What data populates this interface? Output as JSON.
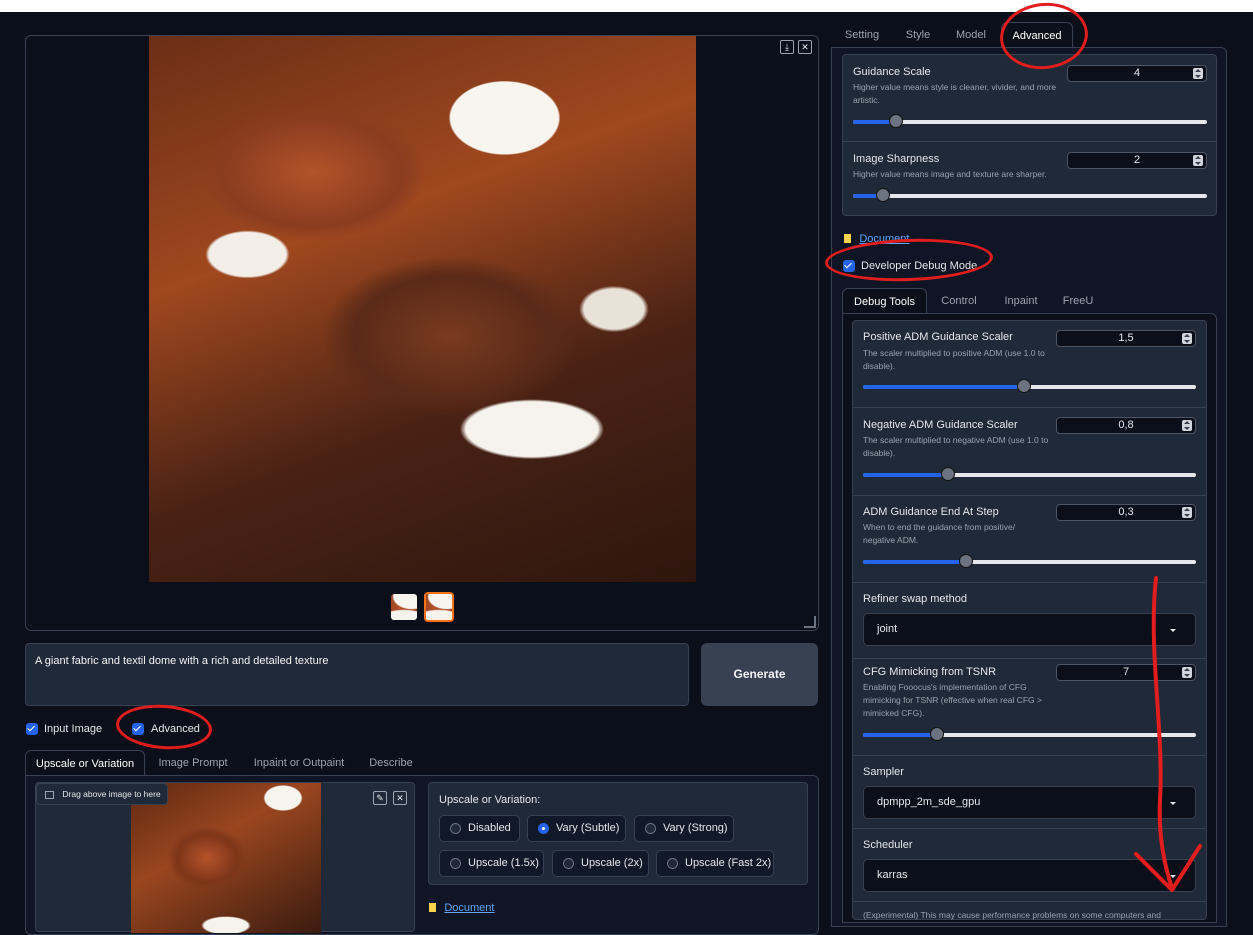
{
  "gallery": {
    "download_icon": "download-icon",
    "close_icon": "close-icon"
  },
  "prompt": {
    "text": "A giant fabric and textil dome with a rich and detailed texture"
  },
  "generate_label": "Generate",
  "options": {
    "input_image_label": "Input Image",
    "advanced_label": "Advanced"
  },
  "input_tabs": [
    "Upscale or Variation",
    "Image Prompt",
    "Inpaint or Outpaint",
    "Describe"
  ],
  "drop_zone": {
    "hint": "Drag above image to here"
  },
  "upscale": {
    "title": "Upscale or Variation:",
    "options": [
      "Disabled",
      "Vary (Subtle)",
      "Vary (Strong)",
      "Upscale (1.5x)",
      "Upscale (2x)",
      "Upscale (Fast 2x)"
    ],
    "selected": "Vary (Subtle)",
    "document_link": "Document"
  },
  "right_tabs": [
    "Setting",
    "Style",
    "Model",
    "Advanced"
  ],
  "advanced": {
    "guidance_scale": {
      "label": "Guidance Scale",
      "desc": "Higher value means style is cleaner, vivider, and more artistic.",
      "value": "4",
      "min": 1,
      "max": 30,
      "numeric": 4
    },
    "image_sharpness": {
      "label": "Image Sharpness",
      "desc": "Higher value means image and texture are sharper.",
      "value": "2",
      "min": 0,
      "max": 30,
      "numeric": 2
    },
    "document_link": "Document",
    "debug_mode_label": "Developer Debug Mode"
  },
  "debug_tabs": [
    "Debug Tools",
    "Control",
    "Inpaint",
    "FreeU"
  ],
  "debug": {
    "positive_adm": {
      "label": "Positive ADM Guidance Scaler",
      "desc": "The scaler multiplied to positive ADM (use 1.0 to disable).",
      "value": "1,5",
      "fraction": 0.48
    },
    "negative_adm": {
      "label": "Negative ADM Guidance Scaler",
      "desc": "The scaler multiplied to negative ADM (use 1.0 to disable).",
      "value": "0,8",
      "fraction": 0.26
    },
    "adm_end": {
      "label": "ADM Guidance End At Step",
      "desc": "When to end the guidance from positive/ negative ADM.",
      "value": "0,3",
      "fraction": 0.31
    },
    "refiner_swap": {
      "label": "Refiner swap method",
      "value": "joint"
    },
    "cfg_tsnr": {
      "label": "CFG Mimicking from TSNR",
      "desc": "Enabling Fooocus's implementation of CFG mimicking for TSNR (effective when real CFG > mimicked CFG).",
      "value": "7",
      "fraction": 0.22
    },
    "sampler": {
      "label": "Sampler",
      "value": "dpmpp_2m_sde_gpu"
    },
    "scheduler": {
      "label": "Scheduler",
      "value": "karras"
    },
    "experimental_note": "(Experimental) This may cause performance problems on some computers and"
  },
  "colors": {
    "background": "#0b0f19",
    "accent": "#2563eb",
    "annotation": "#e11d1d",
    "thumb_selected": "#f97316"
  }
}
